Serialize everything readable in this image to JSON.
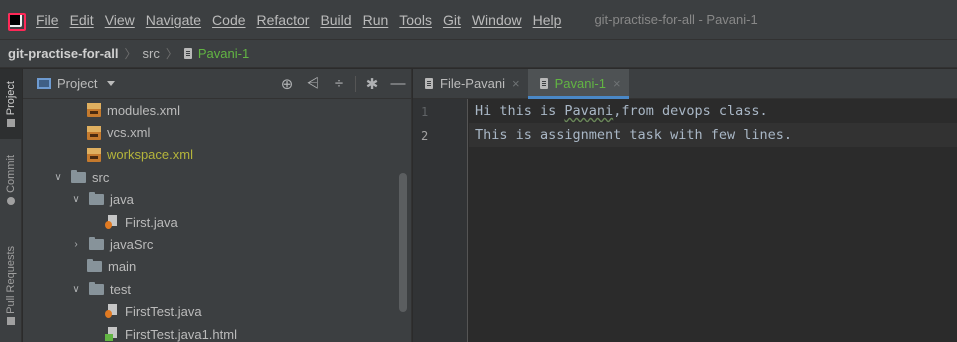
{
  "menubar": {
    "app_icon": "intellij-logo-icon",
    "items": [
      "File",
      "Edit",
      "View",
      "Navigate",
      "Code",
      "Refactor",
      "Build",
      "Run",
      "Tools",
      "Git",
      "Window",
      "Help"
    ],
    "window_title": "git-practise-for-all - Pavani-1"
  },
  "navbar": {
    "project": "git-practise-for-all",
    "folder": "src",
    "file": "Pavani-1"
  },
  "tool_stripe": {
    "project": "Project",
    "commit": "Commit",
    "pull_requests": "Pull Requests"
  },
  "project_panel": {
    "title": "Project",
    "actions": [
      "crosshair-icon",
      "expand-all-icon",
      "collapse-all-icon",
      "gear-icon",
      "minimize-icon"
    ],
    "tree": [
      {
        "label": "modules.xml",
        "type": "xml",
        "indent": 3,
        "color": "default"
      },
      {
        "label": "vcs.xml",
        "type": "xml",
        "indent": 3,
        "color": "default"
      },
      {
        "label": "workspace.xml",
        "type": "xml",
        "indent": 3,
        "color": "ignored"
      },
      {
        "label": "src",
        "type": "folder",
        "indent": 1,
        "expanded": true
      },
      {
        "label": "java",
        "type": "folder",
        "indent": 2,
        "expanded": true
      },
      {
        "label": "First.java",
        "type": "java",
        "indent": 4
      },
      {
        "label": "javaSrc",
        "type": "folder",
        "indent": 2,
        "expanded": false
      },
      {
        "label": "main",
        "type": "folder",
        "indent": 3
      },
      {
        "label": "test",
        "type": "folder",
        "indent": 2,
        "expanded": true
      },
      {
        "label": "FirstTest.java",
        "type": "java",
        "indent": 4
      },
      {
        "label": "FirstTest.java1.html",
        "type": "html",
        "indent": 4
      }
    ]
  },
  "editor": {
    "tabs": [
      {
        "label": "File-Pavani",
        "active": false
      },
      {
        "label": "Pavani-1",
        "active": true
      }
    ],
    "lines": [
      {
        "number": "1",
        "text_before": "Hi this is ",
        "typo": "Pavani",
        "text_after": ",from devops class."
      },
      {
        "number": "2",
        "text_before": "This is assignment task with few lines.",
        "typo": "",
        "text_after": ""
      }
    ]
  },
  "colors": {
    "accent": "#4a88c7",
    "active_file": "#62b543",
    "ignored_file": "#b5b53b"
  }
}
